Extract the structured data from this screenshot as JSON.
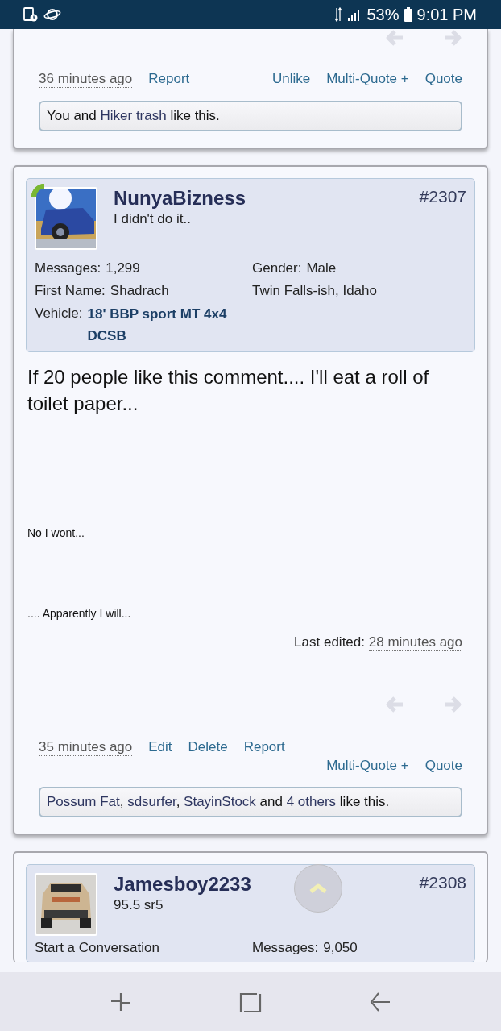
{
  "status_bar": {
    "battery": "53%",
    "time": "9:01 PM"
  },
  "posts": [
    {
      "partial": true,
      "time": "36 minutes ago",
      "actions": [
        "Report"
      ],
      "right_actions": [
        "Unlike",
        "Multi-Quote +",
        "Quote"
      ],
      "actions_wrap": false,
      "likes": [
        {
          "text": "You and ",
          "link": false
        },
        {
          "text": "Hiker trash",
          "link": true
        },
        {
          "text": " like this.",
          "link": false
        }
      ]
    },
    {
      "partial": false,
      "author": "NunyaBizness",
      "user_title": "I didn't do it..",
      "number": "#2307",
      "online": true,
      "fields": [
        {
          "label": "Messages:",
          "value": "1,299",
          "link": false
        },
        {
          "label": "Gender:",
          "value": "Male",
          "link": false
        },
        {
          "label": "First Name:",
          "value": "Shadrach",
          "link": false
        },
        {
          "value": "Twin Falls-ish, Idaho",
          "link": false
        },
        {
          "label": "Vehicle:",
          "value": "18' BBP sport MT 4x4 DCSB",
          "link": true
        }
      ],
      "message": [
        {
          "kind": "large",
          "text": "If 20 people like this comment.... I'll eat a roll of toilet paper..."
        },
        {
          "kind": "small",
          "text": "No I wont..."
        },
        {
          "kind": "small",
          "text": ".... Apparently I will..."
        }
      ],
      "edited_label": "Last edited:",
      "edited_time": "28 minutes ago",
      "time": "35 minutes ago",
      "actions": [
        "Edit",
        "Delete",
        "Report"
      ],
      "right_actions": [
        "Multi-Quote +",
        "Quote"
      ],
      "actions_wrap": true,
      "likes": [
        {
          "text": "Possum Fat",
          "link": true
        },
        {
          "text": ", ",
          "link": false
        },
        {
          "text": "sdsurfer",
          "link": true
        },
        {
          "text": ", ",
          "link": false
        },
        {
          "text": "StayinStock",
          "link": true
        },
        {
          "text": " and ",
          "link": false
        },
        {
          "text": "4 others",
          "link": true
        },
        {
          "text": " like this.",
          "link": false
        }
      ]
    },
    {
      "partial": false,
      "author": "Jamesboy2233",
      "user_title": "95.5 sr5",
      "number": "#2308",
      "online": false,
      "fields": [
        {
          "value": "Start a Conversation",
          "link": false
        },
        {
          "label": "Messages:",
          "value": "9,050",
          "link": false
        }
      ]
    }
  ]
}
